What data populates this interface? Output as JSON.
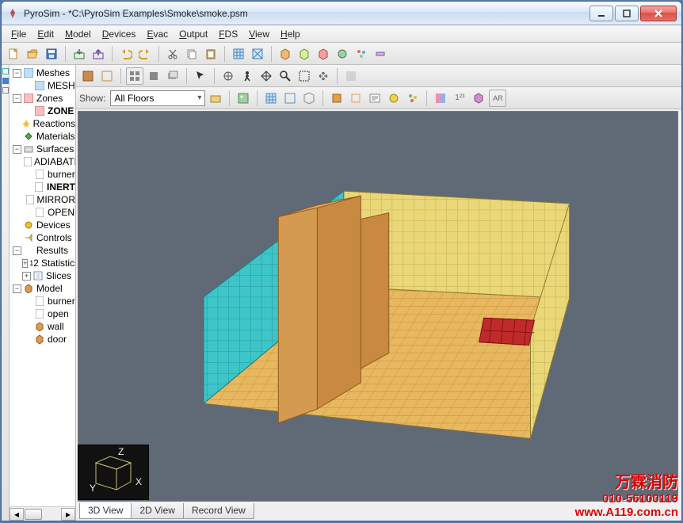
{
  "title": "PyroSim - *C:\\PyroSim Examples\\Smoke\\smoke.psm",
  "menus": [
    "File",
    "Edit",
    "Model",
    "Devices",
    "Evac",
    "Output",
    "FDS",
    "View",
    "Help"
  ],
  "tree": {
    "meshes": "Meshes",
    "mesh": "MESH",
    "zones": "Zones",
    "zone": "ZONE",
    "reactions": "Reactions",
    "materials": "Materials",
    "surfaces": "Surfaces",
    "surf_items": [
      "ADIABATIC",
      "burner",
      "INERT",
      "MIRROR",
      "OPEN"
    ],
    "devices": "Devices",
    "controls": "Controls",
    "results": "Results",
    "statistics": "Statistics",
    "slices": "Slices",
    "model": "Model",
    "model_items": [
      "burner",
      "open",
      "wall",
      "door"
    ]
  },
  "show_label": "Show:",
  "floor_combo": "All Floors",
  "tabs": [
    "3D View",
    "2D View",
    "Record View"
  ],
  "watermark": {
    "l1": "万霖消防",
    "l2": "010-56100119",
    "l3": "www.A119.com.cn"
  },
  "orient_axes": [
    "X",
    "Y",
    "Z"
  ]
}
